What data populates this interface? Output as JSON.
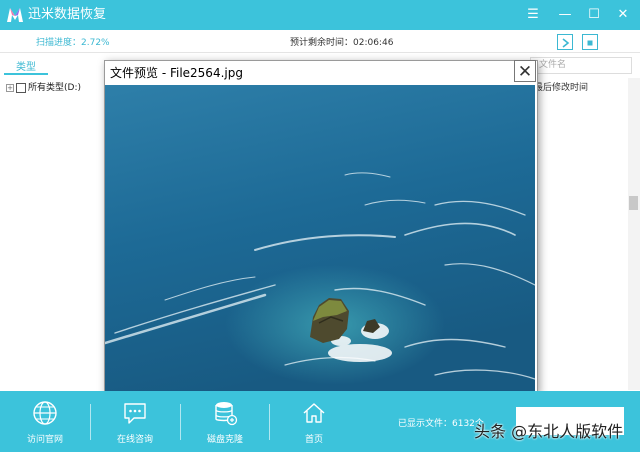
{
  "app": {
    "title": "迅米数据恢复"
  },
  "window_controls": {
    "menu": "☰",
    "minimize": "—",
    "maximize": "☐",
    "close": "✕"
  },
  "scan": {
    "progress_text": "扫描进度：2.72%",
    "eta_text": "预计剩余时间：02:06:46"
  },
  "left_panel": {
    "tab_label": "类型",
    "tree_root": "所有类型(D:)"
  },
  "right_panel": {
    "search_placeholder": "文件名",
    "mod_time_header": "最后修改时间"
  },
  "preview": {
    "title": "文件预览 - File2564.jpg",
    "close_glyph": "✕"
  },
  "toolbar": {
    "items": [
      {
        "label": "访问官网",
        "icon": "globe-icon"
      },
      {
        "label": "在线咨询",
        "icon": "chat-icon"
      },
      {
        "label": "磁盘克隆",
        "icon": "disk-clone-icon"
      },
      {
        "label": "首页",
        "icon": "home-icon"
      }
    ],
    "shown_files": "已显示文件：6132个"
  },
  "watermark": "头条 @东北人版软件",
  "colors": {
    "accent": "#3cc3db",
    "sea": "#1f6a94"
  }
}
